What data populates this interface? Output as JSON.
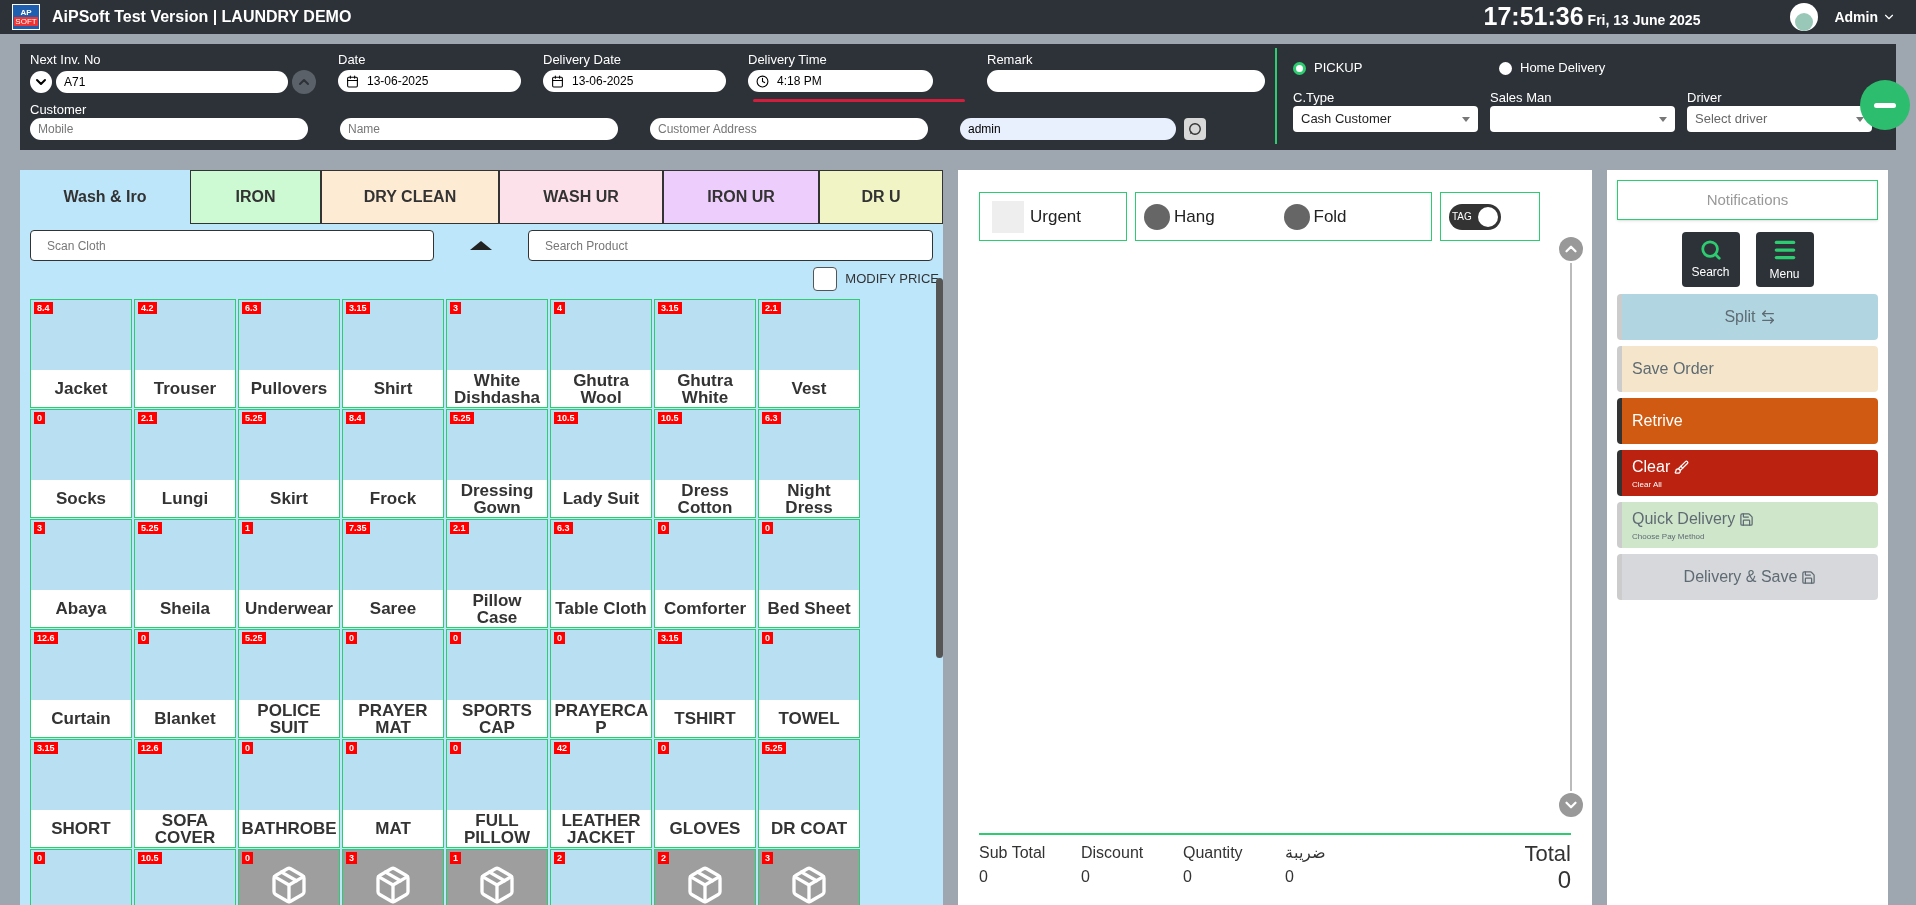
{
  "topbar": {
    "title": "AiPSoft Test Version | LAUNDRY DEMO",
    "logo_text": "AP",
    "logo_sub": "SOFT",
    "time": "17:51:36",
    "date": "Fri, 13 June 2025",
    "user": "Admin"
  },
  "order_header": {
    "fields": [
      {
        "label": "Next Inv. No",
        "value": "A71",
        "kind": "invoice"
      },
      {
        "label": "Date",
        "value": "13-06-2025",
        "kind": "date"
      },
      {
        "label": "Delivery Date",
        "value": "13-06-2025",
        "kind": "date"
      },
      {
        "label": "Delivery Time",
        "value": "4:18 PM",
        "kind": "time"
      },
      {
        "label": "Remark",
        "kind": "text"
      }
    ],
    "customer": {
      "label": "Customer",
      "fields": [
        {
          "placeholder": "Mobile"
        },
        {
          "placeholder": "Name"
        },
        {
          "placeholder": "Customer Address"
        }
      ],
      "user_value": "admin"
    },
    "delivery_modes": [
      {
        "label": "PICKUP",
        "selected": true
      },
      {
        "label": "Home Delivery",
        "selected": false
      }
    ],
    "selects": [
      {
        "label": "C.Type",
        "value": "Cash Customer"
      },
      {
        "label": "Sales Man"
      },
      {
        "label": "Driver",
        "placeholder": "Select driver"
      }
    ]
  },
  "service_tabs": [
    {
      "label": "Wash & Iro",
      "selected": true,
      "color": "#bde6fb"
    },
    {
      "label": "IRON",
      "selected": false,
      "color": "#cdfad2"
    },
    {
      "label": "DRY CLEAN",
      "selected": false,
      "color": "#feebd3"
    },
    {
      "label": "WASH UR",
      "selected": false,
      "color": "#fde1ea"
    },
    {
      "label": "IRON UR",
      "selected": false,
      "color": "#edcdfb"
    },
    {
      "label": "DR U",
      "selected": false,
      "color": "#f1f4c4"
    }
  ],
  "scan_field": {
    "placeholder": "Scan Cloth"
  },
  "search_field": {
    "placeholder": "Search Product"
  },
  "modify_price": {
    "label": "MODIFY PRICE",
    "checked": false
  },
  "products": [
    {
      "name": "Jacket",
      "price": "8.4"
    },
    {
      "name": "Trouser",
      "price": "4.2"
    },
    {
      "name": "Pullovers",
      "price": "6.3"
    },
    {
      "name": "Shirt",
      "price": "3.15"
    },
    {
      "name": "White Dishdasha",
      "price": "3"
    },
    {
      "name": "Ghutra Wool",
      "price": "4"
    },
    {
      "name": "Ghutra White",
      "price": "3.15"
    },
    {
      "name": "Vest",
      "price": "2.1"
    },
    {
      "name": "Socks",
      "price": "0"
    },
    {
      "name": "Lungi",
      "price": "2.1"
    },
    {
      "name": "Skirt",
      "price": "5.25"
    },
    {
      "name": "Frock",
      "price": "8.4"
    },
    {
      "name": "Dressing Gown",
      "price": "5.25"
    },
    {
      "name": "Lady Suit",
      "price": "10.5"
    },
    {
      "name": "Dress Cotton",
      "price": "10.5"
    },
    {
      "name": "Night Dress",
      "price": "6.3"
    },
    {
      "name": "Abaya",
      "price": "3"
    },
    {
      "name": "Sheila",
      "price": "5.25"
    },
    {
      "name": "Underwear",
      "price": "1"
    },
    {
      "name": "Saree",
      "price": "7.35"
    },
    {
      "name": "Pillow Case",
      "price": "2.1"
    },
    {
      "name": "Table Cloth",
      "price": "6.3"
    },
    {
      "name": "Comforter",
      "price": "0"
    },
    {
      "name": "Bed Sheet",
      "price": "0"
    },
    {
      "name": "Curtain",
      "price": "12.6"
    },
    {
      "name": "Blanket",
      "price": "0"
    },
    {
      "name": "POLICE SUIT",
      "price": "5.25"
    },
    {
      "name": "PRAYER MAT",
      "price": "0"
    },
    {
      "name": "SPORTS CAP",
      "price": "0"
    },
    {
      "name": "PRAYERCA P",
      "price": "0"
    },
    {
      "name": "TSHIRT",
      "price": "3.15"
    },
    {
      "name": "TOWEL",
      "price": "0"
    },
    {
      "name": "SHORT",
      "price": "3.15"
    },
    {
      "name": "SOFA COVER",
      "price": "12.6"
    },
    {
      "name": "BATHROBE",
      "price": "0"
    },
    {
      "name": "MAT",
      "price": "0"
    },
    {
      "name": "FULL PILLOW",
      "price": "0"
    },
    {
      "name": "LEATHER JACKET",
      "price": "42"
    },
    {
      "name": "GLOVES",
      "price": "0"
    },
    {
      "name": "DR COAT",
      "price": "5.25"
    },
    {
      "price": "0",
      "kind": "photo"
    },
    {
      "price": "10.5",
      "kind": "photo"
    },
    {
      "price": "0",
      "kind": "box"
    },
    {
      "price": "3",
      "kind": "box"
    },
    {
      "price": "1",
      "kind": "box"
    },
    {
      "price": "2",
      "kind": "photo"
    },
    {
      "price": "2",
      "kind": "box"
    },
    {
      "price": "3",
      "kind": "box"
    }
  ],
  "order_options": {
    "urgent": {
      "label": "Urgent",
      "checked": false
    },
    "finish": [
      {
        "label": "Hang",
        "selected": false
      },
      {
        "label": "Fold",
        "selected": false
      }
    ],
    "tag": {
      "label": "TAG",
      "on": true
    }
  },
  "totals": [
    {
      "label": "Sub Total",
      "value": "0"
    },
    {
      "label": "Discount",
      "value": "0"
    },
    {
      "label": "Quantity",
      "value": "0"
    },
    {
      "label": "ضريبة",
      "value": "0"
    }
  ],
  "total": {
    "label": "Total",
    "value": "0"
  },
  "notifications": {
    "label": "Notifications"
  },
  "tool_buttons": [
    {
      "label": "Search",
      "kind": "search"
    },
    {
      "label": "Menu",
      "kind": "menu"
    }
  ],
  "actions": [
    {
      "label": "Split",
      "color": "#b1d6e2",
      "disabled": true
    },
    {
      "label": "Save Order",
      "color": "#f5e6cb",
      "disabled": true
    },
    {
      "label": "Retrive",
      "color": "#d15a12",
      "disabled": false
    },
    {
      "label": "Clear",
      "sub": "Clear All",
      "color": "#bb2210",
      "disabled": false
    },
    {
      "label": "Quick Delivery",
      "sub": "Choose Pay Method",
      "color": "#cfe6cb",
      "disabled": true
    },
    {
      "label": "Delivery & Save",
      "color": "#d6d8db",
      "disabled": true
    }
  ]
}
